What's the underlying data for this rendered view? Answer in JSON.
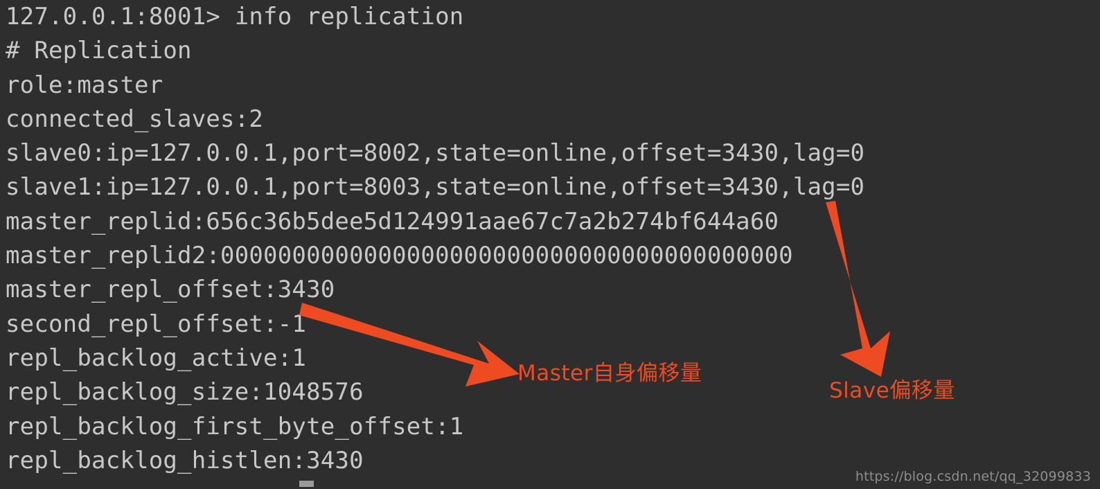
{
  "terminal": {
    "background_color": "#2e2e2e",
    "text_color": "#c8c8c8",
    "lines": [
      {
        "id": "prompt-command",
        "text": "127.0.0.1:8001> info replication"
      },
      {
        "id": "section-header",
        "text": "# Replication"
      },
      {
        "id": "role",
        "text": "role:master"
      },
      {
        "id": "connected-slaves",
        "text": "connected_slaves:2"
      },
      {
        "id": "slave0",
        "text": "slave0:ip=127.0.0.1,port=8002,state=online,offset=3430,lag=0"
      },
      {
        "id": "slave1",
        "text": "slave1:ip=127.0.0.1,port=8003,state=online,offset=3430,lag=0"
      },
      {
        "id": "master-replid",
        "text": "master_replid:656c36b5dee5d124991aae67c7a2b274bf644a60"
      },
      {
        "id": "master-replid2",
        "text": "master_replid2:0000000000000000000000000000000000000000"
      },
      {
        "id": "master-repl-offset",
        "text": "master_repl_offset:3430"
      },
      {
        "id": "second-repl-offset",
        "text": "second_repl_offset:-1"
      },
      {
        "id": "repl-backlog-active",
        "text": "repl_backlog_active:1"
      },
      {
        "id": "repl-backlog-size",
        "text": "repl_backlog_size:1048576"
      },
      {
        "id": "repl-backlog-first",
        "text": "repl_backlog_first_byte_offset:1"
      },
      {
        "id": "repl-backlog-histlen",
        "text": "repl_backlog_histlen:3430"
      }
    ]
  },
  "annotations": {
    "color": "#ee4b22",
    "master_offset_label": "Master自身偏移量",
    "slave_offset_label": "Slave偏移量"
  },
  "watermark": {
    "text": "https://blog.csdn.net/qq_32099833"
  }
}
